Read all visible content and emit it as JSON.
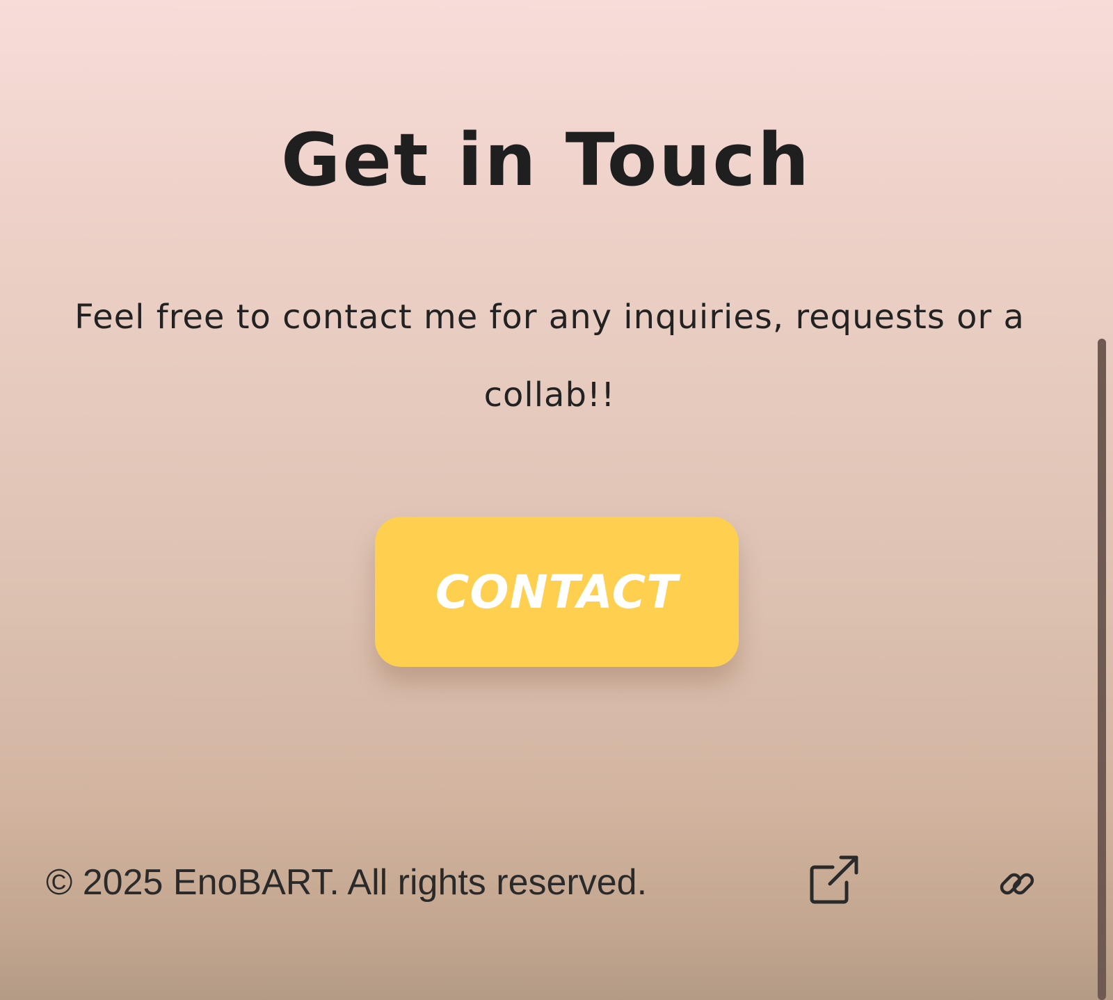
{
  "contact_section": {
    "title": "Get in Touch",
    "description": "Feel free to contact me for any inquiries, requests or a collab!!",
    "button_label": "CONTACT",
    "button_color": "#ffd04f"
  },
  "footer": {
    "copyright": "© 2025 EnoBART. All rights reserved.",
    "icons": [
      "external-link-icon",
      "link-chain-icon"
    ]
  },
  "colors": {
    "background_top": "#f7dcd9",
    "background_bottom": "#b39b86",
    "text": "#1f1f1f",
    "button_text": "#ffffff",
    "scrollbar": "#6f5a51"
  }
}
